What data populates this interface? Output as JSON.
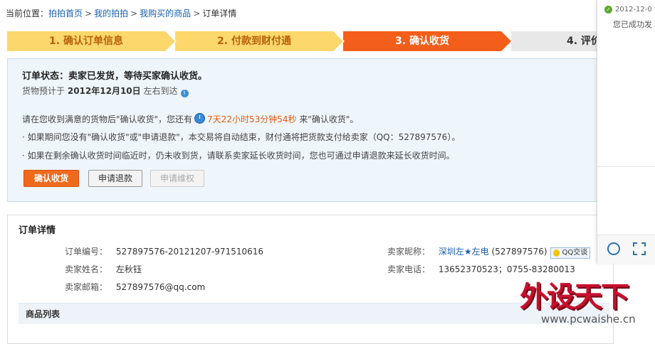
{
  "breadcrumb": {
    "prefix": "当前位置：",
    "items": [
      "拍拍首页",
      "我的拍拍",
      "我购买的商品"
    ],
    "separator": ">",
    "current": "订单详情"
  },
  "steps": [
    {
      "label": "1. 确认订单信息",
      "state": "done"
    },
    {
      "label": "2. 付款到财付通",
      "state": "done"
    },
    {
      "label": "3. 确认收货",
      "state": "active"
    },
    {
      "label": "4. 评价",
      "state": "todo"
    }
  ],
  "status": {
    "title": "订单状态：卖家已发货，等待买家确认收货。",
    "eta_prefix": "货物预计于",
    "eta_date": "2012年12月10日",
    "eta_suffix": "左右到达",
    "notice_prefix": "请在您收到满意的货物后\"确认收货\"，您还有",
    "countdown": "7天22小时53分钟54秒",
    "notice_suffix": "来\"确认收货\"。",
    "bullet1": "· 如果期间您没有\"确认收货\"或\"申请退款\"，本交易将自动结束，财付通将把货款支付给卖家（QQ：527897576）。",
    "bullet2": "· 如果在剩余确认收货时间临近时，仍未收到货，请联系卖家延长收货时间，您也可通过申请退款来延长收货时间。",
    "buttons": {
      "confirm": "确认收货",
      "refund": "申请退款",
      "dispute": "申请维权"
    }
  },
  "order_detail": {
    "title": "订单详情",
    "order_no_label": "订单编号：",
    "order_no": "527897576-20121207-971510616",
    "seller_name_label": "卖家姓名：",
    "seller_name": "左秋钰",
    "seller_email_label": "卖家邮箱：",
    "seller_email": "527897576@qq.com",
    "seller_nick_label": "卖家昵称：",
    "seller_nick": "深圳左★左电",
    "seller_qq": "(527897576)",
    "qq_chat": "QQ交谈",
    "seller_phone_label": "卖家电话：",
    "seller_phone": "13652370523；0755-83280013"
  },
  "goods_list": {
    "title": "商品列表"
  },
  "side_panel": {
    "time": "2012-12-0",
    "message": "您已成功发"
  },
  "watermark": {
    "big": "外设天下",
    "url": "www.pcwaishe.cn"
  }
}
